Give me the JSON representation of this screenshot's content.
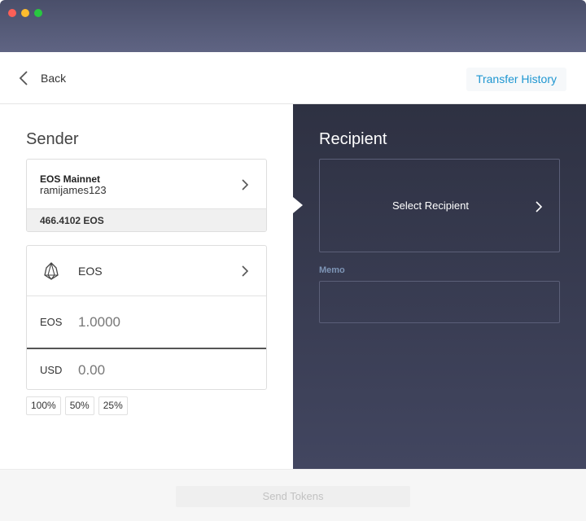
{
  "header": {
    "back_label": "Back",
    "history_label": "Transfer History"
  },
  "sender": {
    "title": "Sender",
    "account": {
      "network": "EOS Mainnet",
      "name": "ramijames123",
      "balance": "466.4102 EOS"
    },
    "token": {
      "name": "EOS",
      "amount_label": "EOS",
      "amount_value": "1.0000",
      "fiat_label": "USD",
      "fiat_value": "0.00"
    },
    "percent_buttons": [
      "100%",
      "50%",
      "25%"
    ]
  },
  "recipient": {
    "title": "Recipient",
    "select_label": "Select Recipient",
    "memo_label": "Memo",
    "memo_value": ""
  },
  "footer": {
    "send_label": "Send Tokens"
  },
  "colors": {
    "accent": "#1e96d1",
    "panel_dark": "#2e3142",
    "memo_label": "#7e95b6"
  },
  "icons": {
    "back": "chevron-left-icon",
    "chevron": "chevron-right-icon",
    "token": "eos-logo-icon"
  }
}
